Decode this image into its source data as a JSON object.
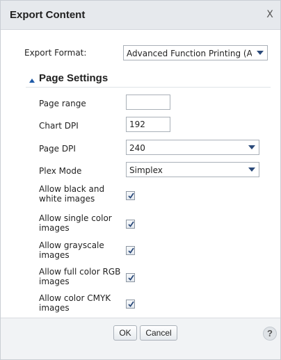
{
  "dialog": {
    "title": "Export Content",
    "close_glyph": "X",
    "close_icon": "close-icon"
  },
  "format": {
    "label": "Export Format:",
    "value": "Advanced Function Printing (AFP)"
  },
  "page_settings": {
    "title": "Page Settings",
    "icon": "collapse-caret-icon",
    "page_range": {
      "label": "Page range",
      "value": ""
    },
    "chart_dpi": {
      "label": "Chart DPI",
      "value": "192"
    },
    "page_dpi": {
      "label": "Page DPI",
      "value": "240"
    },
    "plex_mode": {
      "label": "Plex Mode",
      "value": "Simplex"
    },
    "options": [
      {
        "label": "Allow black and white images",
        "checked": true
      },
      {
        "label": "Allow single color images",
        "checked": true
      },
      {
        "label": "Allow grayscale images",
        "checked": true
      },
      {
        "label": "Allow full color RGB images",
        "checked": true
      },
      {
        "label": "Allow color CMYK images",
        "checked": true
      }
    ]
  },
  "footer": {
    "ok_label": "OK",
    "cancel_label": "Cancel",
    "help_glyph": "?"
  },
  "colors": {
    "titlebar_bg": "#e6e9ed",
    "accent": "#1e5aa8",
    "footer_bg": "#f1f3f5"
  }
}
